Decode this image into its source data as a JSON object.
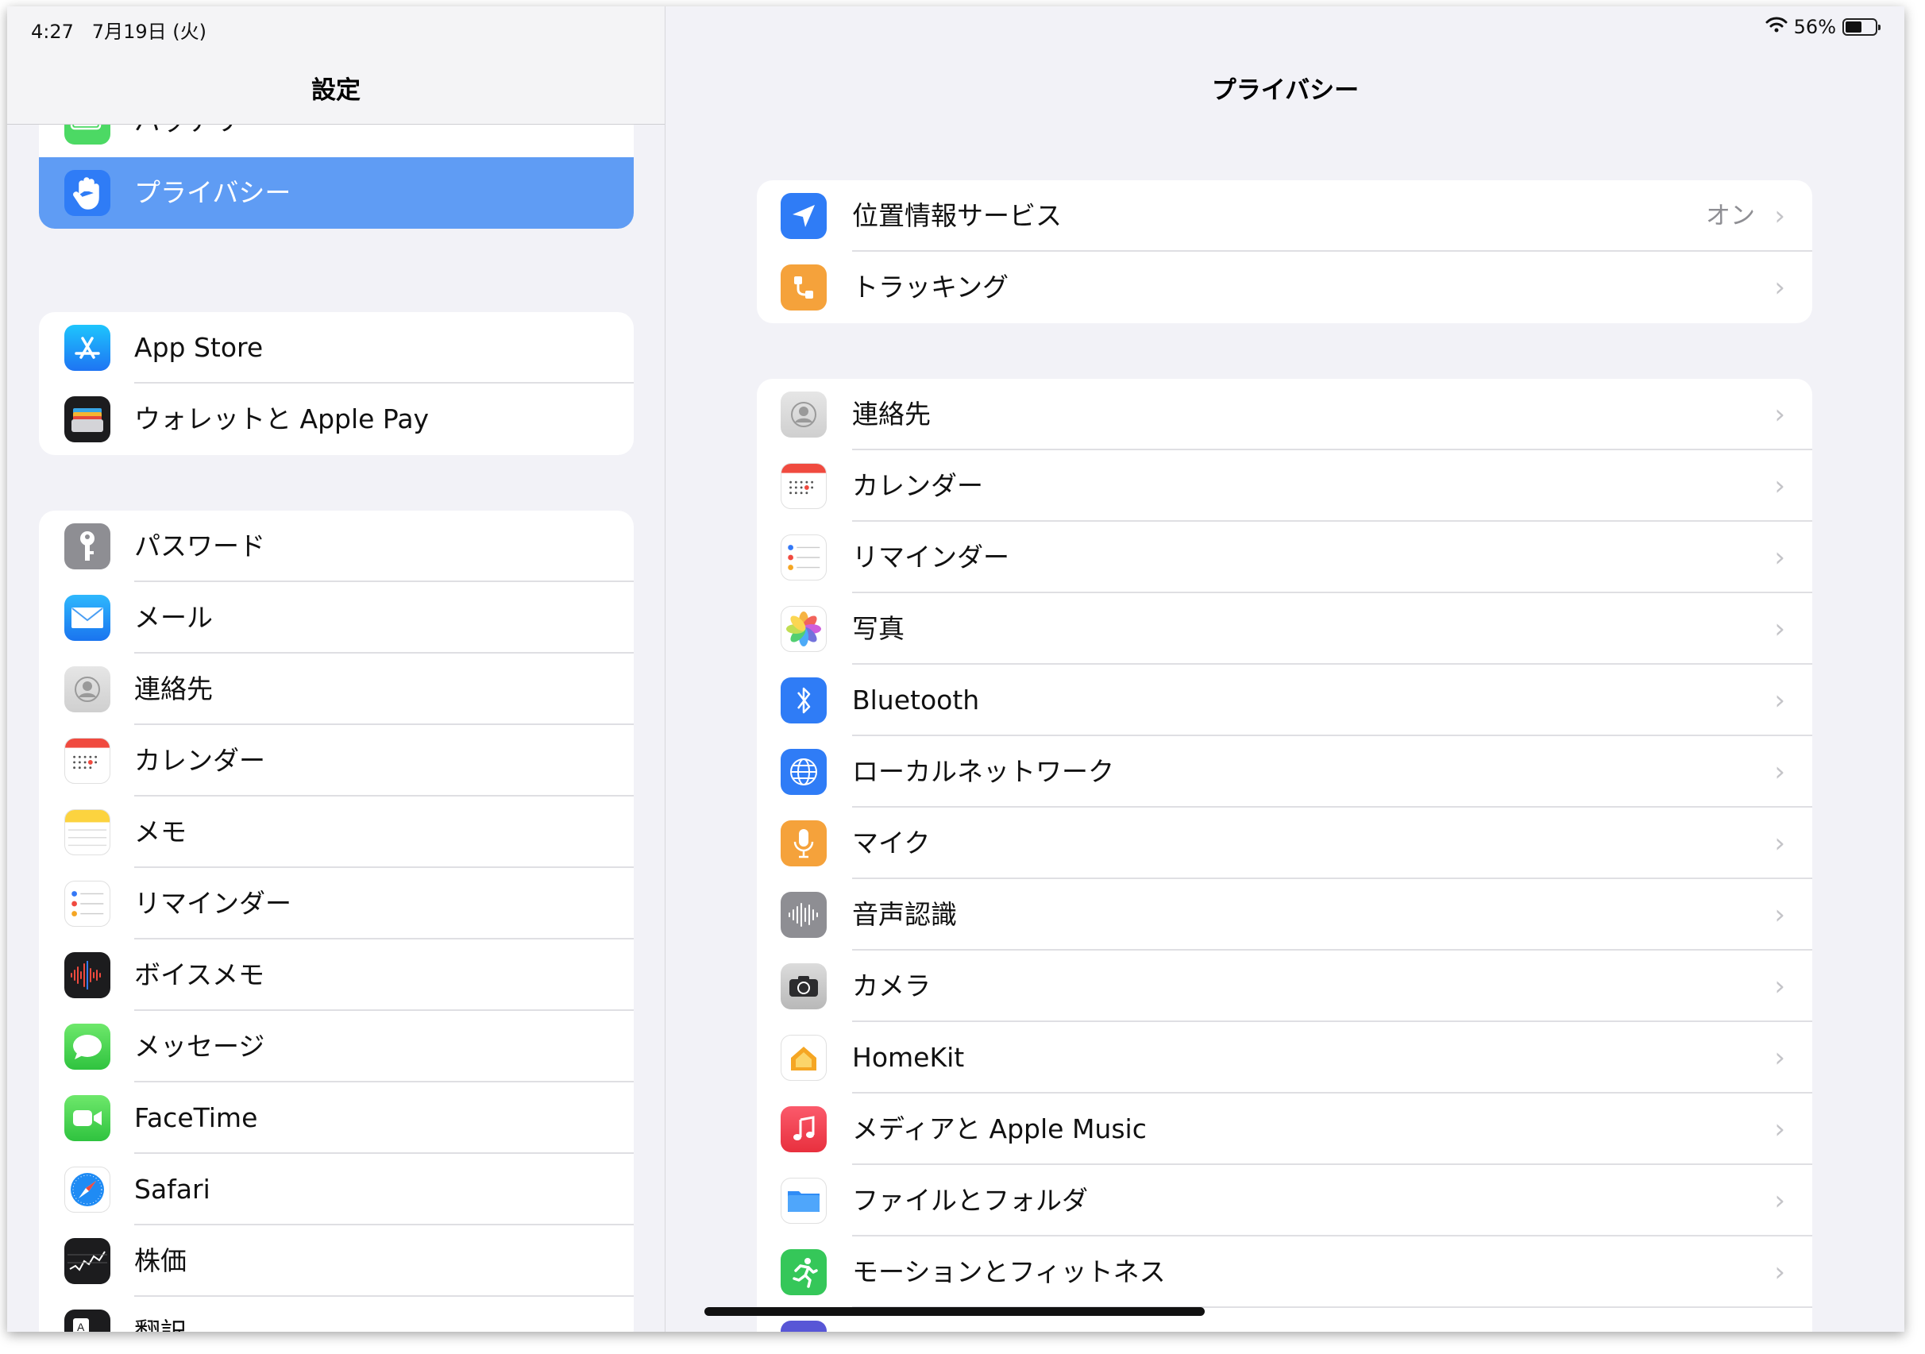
{
  "status": {
    "time": "4:27",
    "date": "7月19日 (火)",
    "battery": "56%",
    "battery_level": 0.56
  },
  "left": {
    "title": "設定",
    "groups": [
      {
        "items": [
          {
            "label": "バッテリー",
            "icon": "battery-icon"
          },
          {
            "label": "プライバシー",
            "icon": "hand-icon",
            "selected": true
          }
        ]
      },
      {
        "items": [
          {
            "label": "App Store",
            "icon": "app-store-icon"
          },
          {
            "label": "ウォレットと Apple Pay",
            "icon": "wallet-icon"
          }
        ]
      },
      {
        "items": [
          {
            "label": "パスワード",
            "icon": "key-icon"
          },
          {
            "label": "メール",
            "icon": "mail-icon"
          },
          {
            "label": "連絡先",
            "icon": "contacts-icon"
          },
          {
            "label": "カレンダー",
            "icon": "calendar-icon"
          },
          {
            "label": "メモ",
            "icon": "notes-icon"
          },
          {
            "label": "リマインダー",
            "icon": "reminders-icon"
          },
          {
            "label": "ボイスメモ",
            "icon": "voice-memos-icon"
          },
          {
            "label": "メッセージ",
            "icon": "messages-icon"
          },
          {
            "label": "FaceTime",
            "icon": "facetime-icon"
          },
          {
            "label": "Safari",
            "icon": "safari-icon"
          },
          {
            "label": "株価",
            "icon": "stocks-icon"
          },
          {
            "label": "翻訳",
            "icon": "translate-icon"
          }
        ]
      }
    ]
  },
  "right": {
    "title": "プライバシー",
    "groups": [
      {
        "items": [
          {
            "label": "位置情報サービス",
            "value": "オン",
            "icon": "location-arrow-icon"
          },
          {
            "label": "トラッキング",
            "icon": "tracking-icon"
          }
        ]
      },
      {
        "items": [
          {
            "label": "連絡先",
            "icon": "contacts-icon"
          },
          {
            "label": "カレンダー",
            "icon": "calendar-icon"
          },
          {
            "label": "リマインダー",
            "icon": "reminders-icon"
          },
          {
            "label": "写真",
            "icon": "photos-icon"
          },
          {
            "label": "Bluetooth",
            "icon": "bluetooth-icon"
          },
          {
            "label": "ローカルネットワーク",
            "icon": "globe-icon"
          },
          {
            "label": "マイク",
            "icon": "microphone-icon"
          },
          {
            "label": "音声認識",
            "icon": "waveform-icon"
          },
          {
            "label": "カメラ",
            "icon": "camera-icon"
          },
          {
            "label": "HomeKit",
            "icon": "home-icon"
          },
          {
            "label": "メディアと Apple Music",
            "icon": "music-icon"
          },
          {
            "label": "ファイルとフォルダ",
            "icon": "folder-icon"
          },
          {
            "label": "モーションとフィットネス",
            "icon": "fitness-icon"
          }
        ]
      }
    ]
  },
  "colors": {
    "selected_row": "#5f9cf4",
    "chevron": "#c4c4c8",
    "background": "#f2f2f7"
  }
}
